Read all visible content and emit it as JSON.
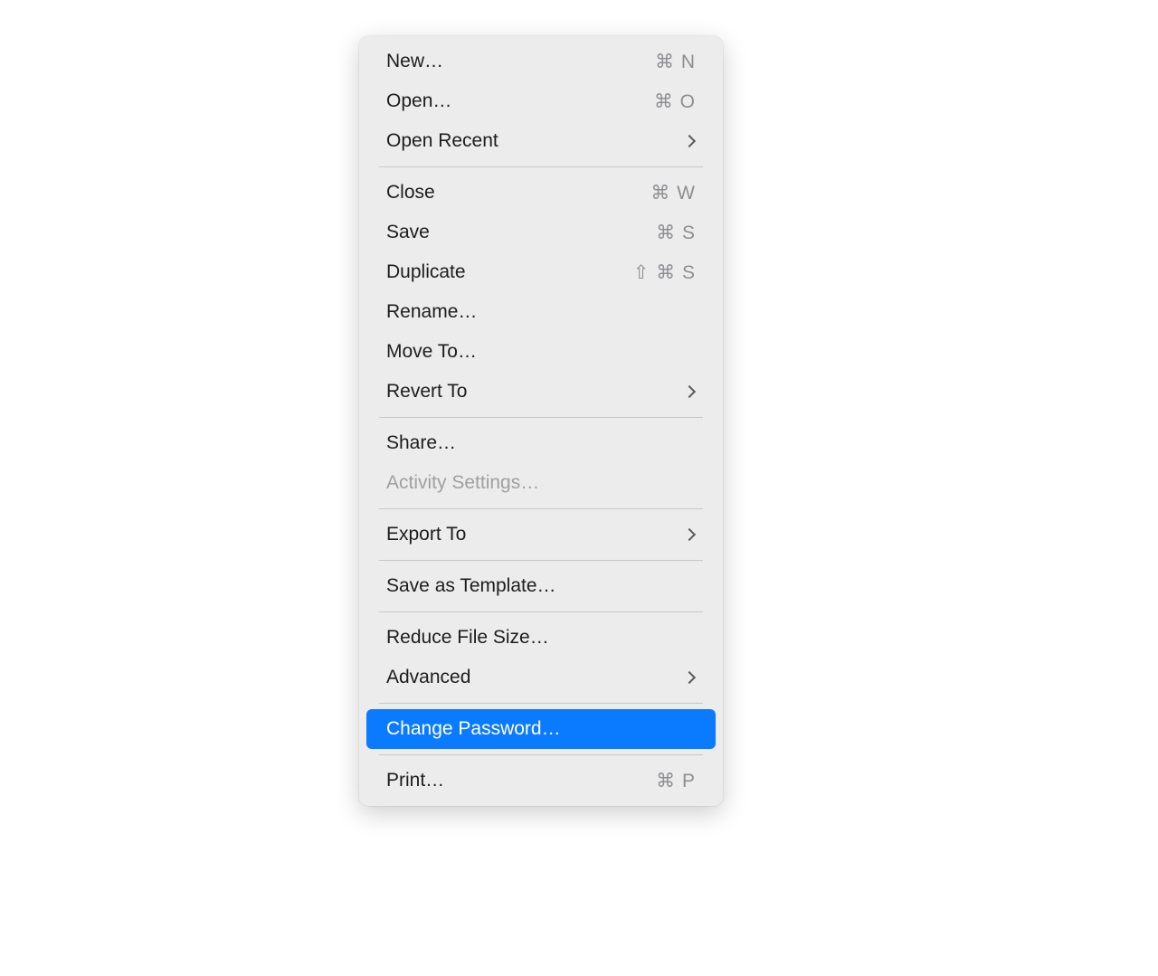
{
  "menu": {
    "items": [
      {
        "label": "New…",
        "shortcut": "⌘ N",
        "type": "shortcut"
      },
      {
        "label": "Open…",
        "shortcut": "⌘ O",
        "type": "shortcut"
      },
      {
        "label": "Open Recent",
        "type": "submenu"
      }
    ],
    "items2": [
      {
        "label": "Close",
        "shortcut": "⌘ W",
        "type": "shortcut"
      },
      {
        "label": "Save",
        "shortcut": "⌘ S",
        "type": "shortcut"
      },
      {
        "label": "Duplicate",
        "shortcut": "⇧ ⌘ S",
        "type": "shortcut"
      },
      {
        "label": "Rename…",
        "type": "plain"
      },
      {
        "label": "Move To…",
        "type": "plain"
      },
      {
        "label": "Revert To",
        "type": "submenu"
      }
    ],
    "items3": [
      {
        "label": "Share…",
        "type": "plain"
      },
      {
        "label": "Activity Settings…",
        "type": "disabled"
      }
    ],
    "items4": [
      {
        "label": "Export To",
        "type": "submenu"
      }
    ],
    "items5": [
      {
        "label": "Save as Template…",
        "type": "plain"
      }
    ],
    "items6": [
      {
        "label": "Reduce File Size…",
        "type": "plain"
      },
      {
        "label": "Advanced",
        "type": "submenu"
      }
    ],
    "items7": [
      {
        "label": "Change Password…",
        "type": "selected"
      }
    ],
    "items8": [
      {
        "label": "Print…",
        "shortcut": "⌘ P",
        "type": "shortcut"
      }
    ]
  }
}
